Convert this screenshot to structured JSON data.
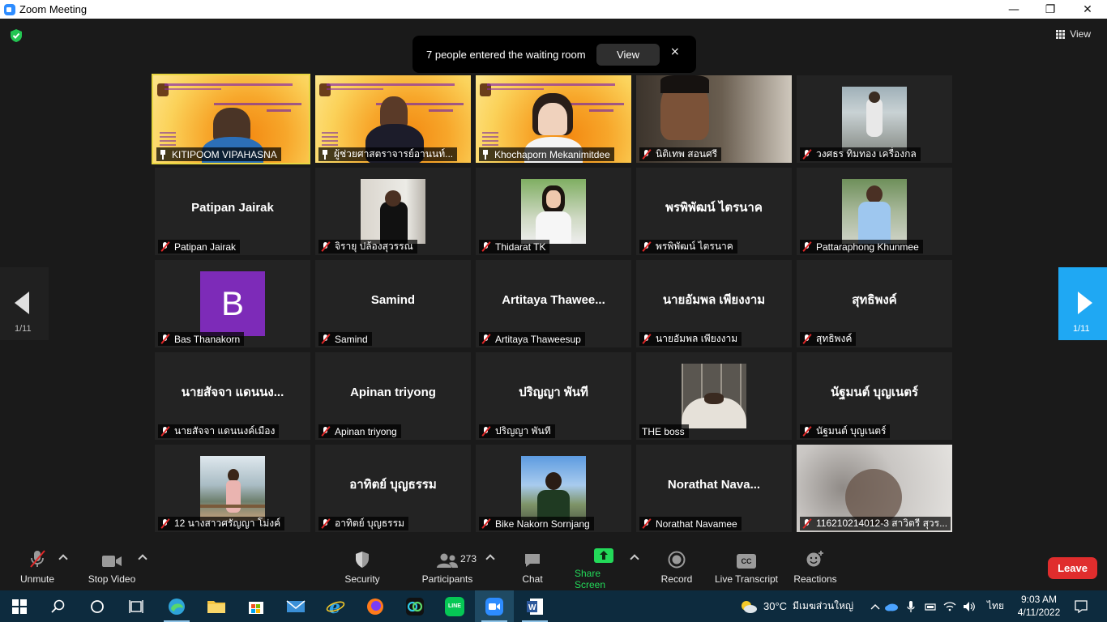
{
  "window": {
    "title": "Zoom Meeting",
    "minimize": "—",
    "maximize": "❐",
    "close": "✕"
  },
  "top": {
    "view_label": "View"
  },
  "toast": {
    "message": "7 people entered the waiting room",
    "view": "View",
    "close": "×"
  },
  "pagination": {
    "left": "1/11",
    "right": "1/11"
  },
  "tiles": [
    {
      "label": "KITIPOOM VIPAHASNA",
      "pinned": true,
      "muted": false
    },
    {
      "label": "ผู้ช่วยศาสตราจารย์อานนท์...",
      "pinned": true,
      "muted": false
    },
    {
      "label": "Khochaporn Mekanimitdee",
      "pinned": true,
      "muted": false
    },
    {
      "label": "นิติเทพ สอนศรี",
      "muted": true
    },
    {
      "label": "วงศธร ทิมทอง เครื่องกล",
      "muted": true
    },
    {
      "big": "Patipan Jairak",
      "label": "Patipan Jairak",
      "muted": true
    },
    {
      "label": "จิรายุ ปล้องสุวรรณ",
      "muted": true
    },
    {
      "label": "Thidarat TK",
      "muted": true
    },
    {
      "big": "พรพิพัฒน์ ไตรนาค",
      "label": "พรพิพัฒน์ ไตรนาค",
      "muted": true
    },
    {
      "label": "Pattaraphong Khunmee",
      "muted": true
    },
    {
      "avatar": "B",
      "label": "Bas Thanakorn",
      "muted": true
    },
    {
      "big": "Samind",
      "label": "Samind",
      "muted": true
    },
    {
      "big": "Artitaya  Thawee...",
      "label": "Artitaya Thaweesup",
      "muted": true
    },
    {
      "big": "นายอัมพล เพียงงาม",
      "label": "นายอัมพล เพียงงาม",
      "muted": true
    },
    {
      "big": "สุทธิพงค์",
      "label": "สุทธิพงค์",
      "muted": true
    },
    {
      "big": "นายสัจจา แดนนง...",
      "label": "นายสัจจา แดนนงค์เมือง",
      "muted": true
    },
    {
      "big": "Apinan triyong",
      "label": "Apinan triyong",
      "muted": true
    },
    {
      "big": "ปริญญา พันที",
      "label": "ปริญญา พันที",
      "muted": true
    },
    {
      "label": "THE boss",
      "muted": false
    },
    {
      "big": "นัฐมนต์ บุญเนตร์",
      "label": "นัฐมนต์ บุญเนตร์",
      "muted": true
    },
    {
      "label": "12 นางสาวศรัญญา โม่งค์",
      "muted": true
    },
    {
      "big": "อาทิตย์  บุญธรรม",
      "label": "อาทิตย์  บุญธรรม",
      "muted": true
    },
    {
      "label": "Bike Nakorn Sornjang",
      "muted": true
    },
    {
      "big": "Norathat  Nava...",
      "label": "Norathat Navamee",
      "muted": true
    },
    {
      "label": "116210214012-3 สาวิตรี สุวร...",
      "muted": true
    }
  ],
  "toolbar": {
    "unmute": "Unmute",
    "stop_video": "Stop Video",
    "security": "Security",
    "participants": "Participants",
    "participants_count": "273",
    "chat": "Chat",
    "share_screen": "Share Screen",
    "record": "Record",
    "live_transcript": "Live Transcript",
    "reactions": "Reactions",
    "leave": "Leave",
    "cc": "CC"
  },
  "taskbar": {
    "weather_temp": "30°C",
    "weather_text": "มีเมฆส่วนใหญ่",
    "lang": "ไทย",
    "time": "9:03 AM",
    "date": "4/11/2022",
    "line": "LINE"
  },
  "colors": {
    "accent": "#2d8cff",
    "leave": "#e02d2d",
    "share": "#23d959",
    "active_border": "#e7d641",
    "next_page": "#1fa8f3"
  }
}
